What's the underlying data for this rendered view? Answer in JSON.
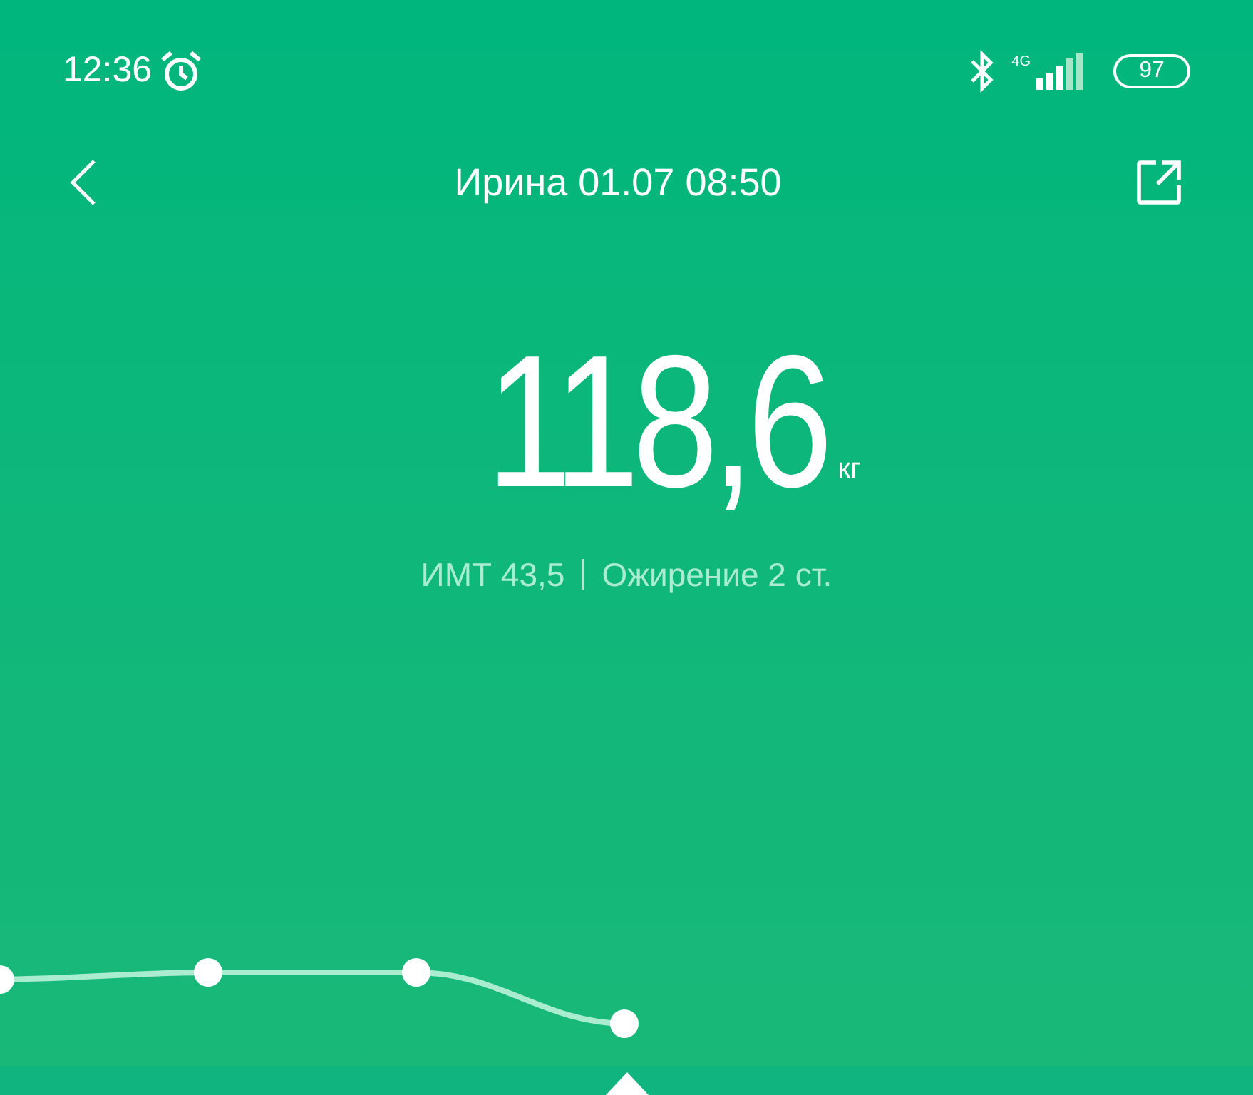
{
  "status_bar": {
    "time": "12:36",
    "network": "4G",
    "battery": "97"
  },
  "header": {
    "title": "Ирина 01.07 08:50"
  },
  "weight": {
    "value": "118,6",
    "unit": "кг"
  },
  "bmi": {
    "label": "ИМТ 43,5",
    "category": "Ожирение 2 ст."
  }
}
